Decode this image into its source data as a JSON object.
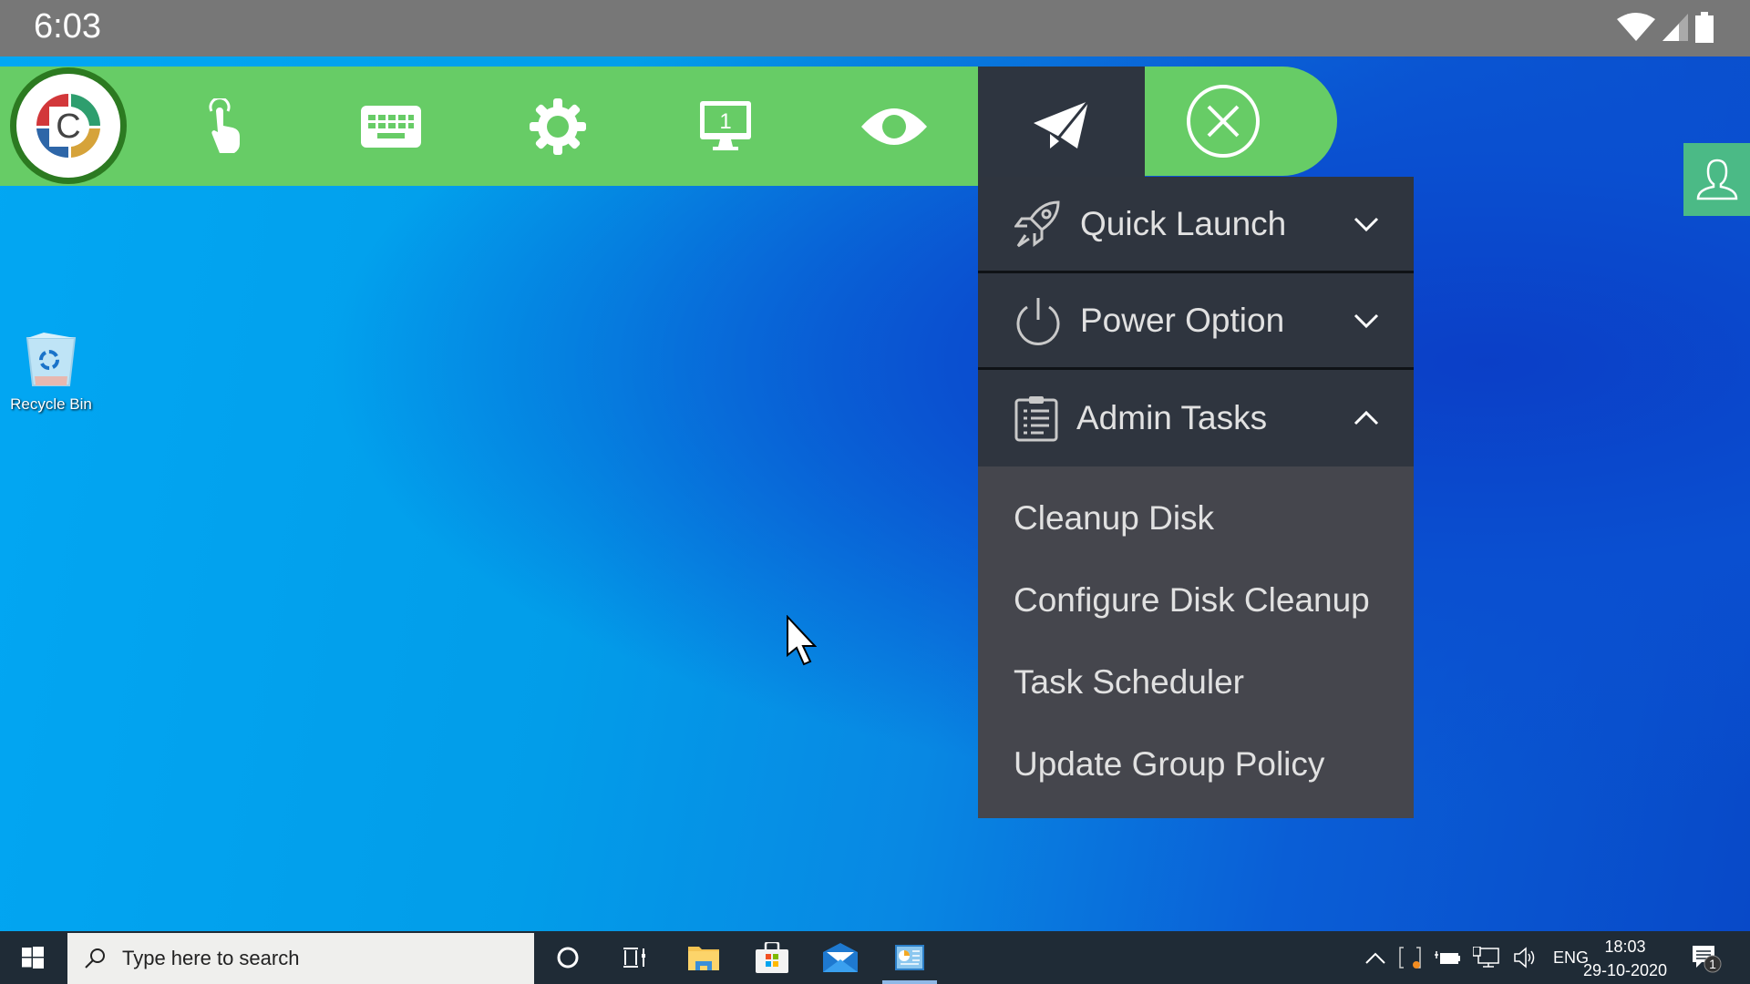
{
  "status_bar": {
    "time": "6:03",
    "icons": [
      "wifi-icon",
      "cell-signal-icon",
      "battery-icon"
    ]
  },
  "toolbar": {
    "logo": {
      "letter": "C",
      "colors": [
        "#d2373a",
        "#2e9e6e",
        "#2e66a8",
        "#d6a33a"
      ]
    },
    "buttons": [
      {
        "name": "touch",
        "icon": "touch-hand-icon"
      },
      {
        "name": "keyboard",
        "icon": "keyboard-icon"
      },
      {
        "name": "settings",
        "icon": "gear-icon"
      },
      {
        "name": "monitor",
        "icon": "monitor-icon",
        "badge": "1"
      },
      {
        "name": "view",
        "icon": "eye-icon"
      },
      {
        "name": "send",
        "icon": "paper-plane-icon",
        "active": true
      },
      {
        "name": "close",
        "icon": "close-circle-icon"
      }
    ],
    "colors": {
      "bar": "#67cc66",
      "active": "#2e3540",
      "logo_ring": "#2c7a21"
    }
  },
  "menu": {
    "sections": [
      {
        "label": "Quick Launch",
        "icon": "rocket-icon",
        "expanded": false
      },
      {
        "label": "Power Option",
        "icon": "power-icon",
        "expanded": false
      },
      {
        "label": "Admin Tasks",
        "icon": "clipboard-icon",
        "expanded": true
      }
    ],
    "admin_tasks_items": [
      "Cleanup Disk",
      "Configure Disk Cleanup",
      "Task Scheduler",
      "Update Group Policy"
    ]
  },
  "desktop": {
    "icons": [
      {
        "label": "Recycle Bin"
      }
    ]
  },
  "side_button": {
    "icon": "user-icon",
    "color": "#4bba86"
  },
  "taskbar": {
    "search_placeholder": "Type here to search",
    "pinned": [
      "cortana-icon",
      "task-view-icon",
      "file-explorer-icon",
      "store-icon",
      "mail-icon",
      "remote-app-icon"
    ],
    "tray": {
      "language": "ENG",
      "time": "18:03",
      "date": "29-10-2020",
      "notifications": "1"
    }
  }
}
